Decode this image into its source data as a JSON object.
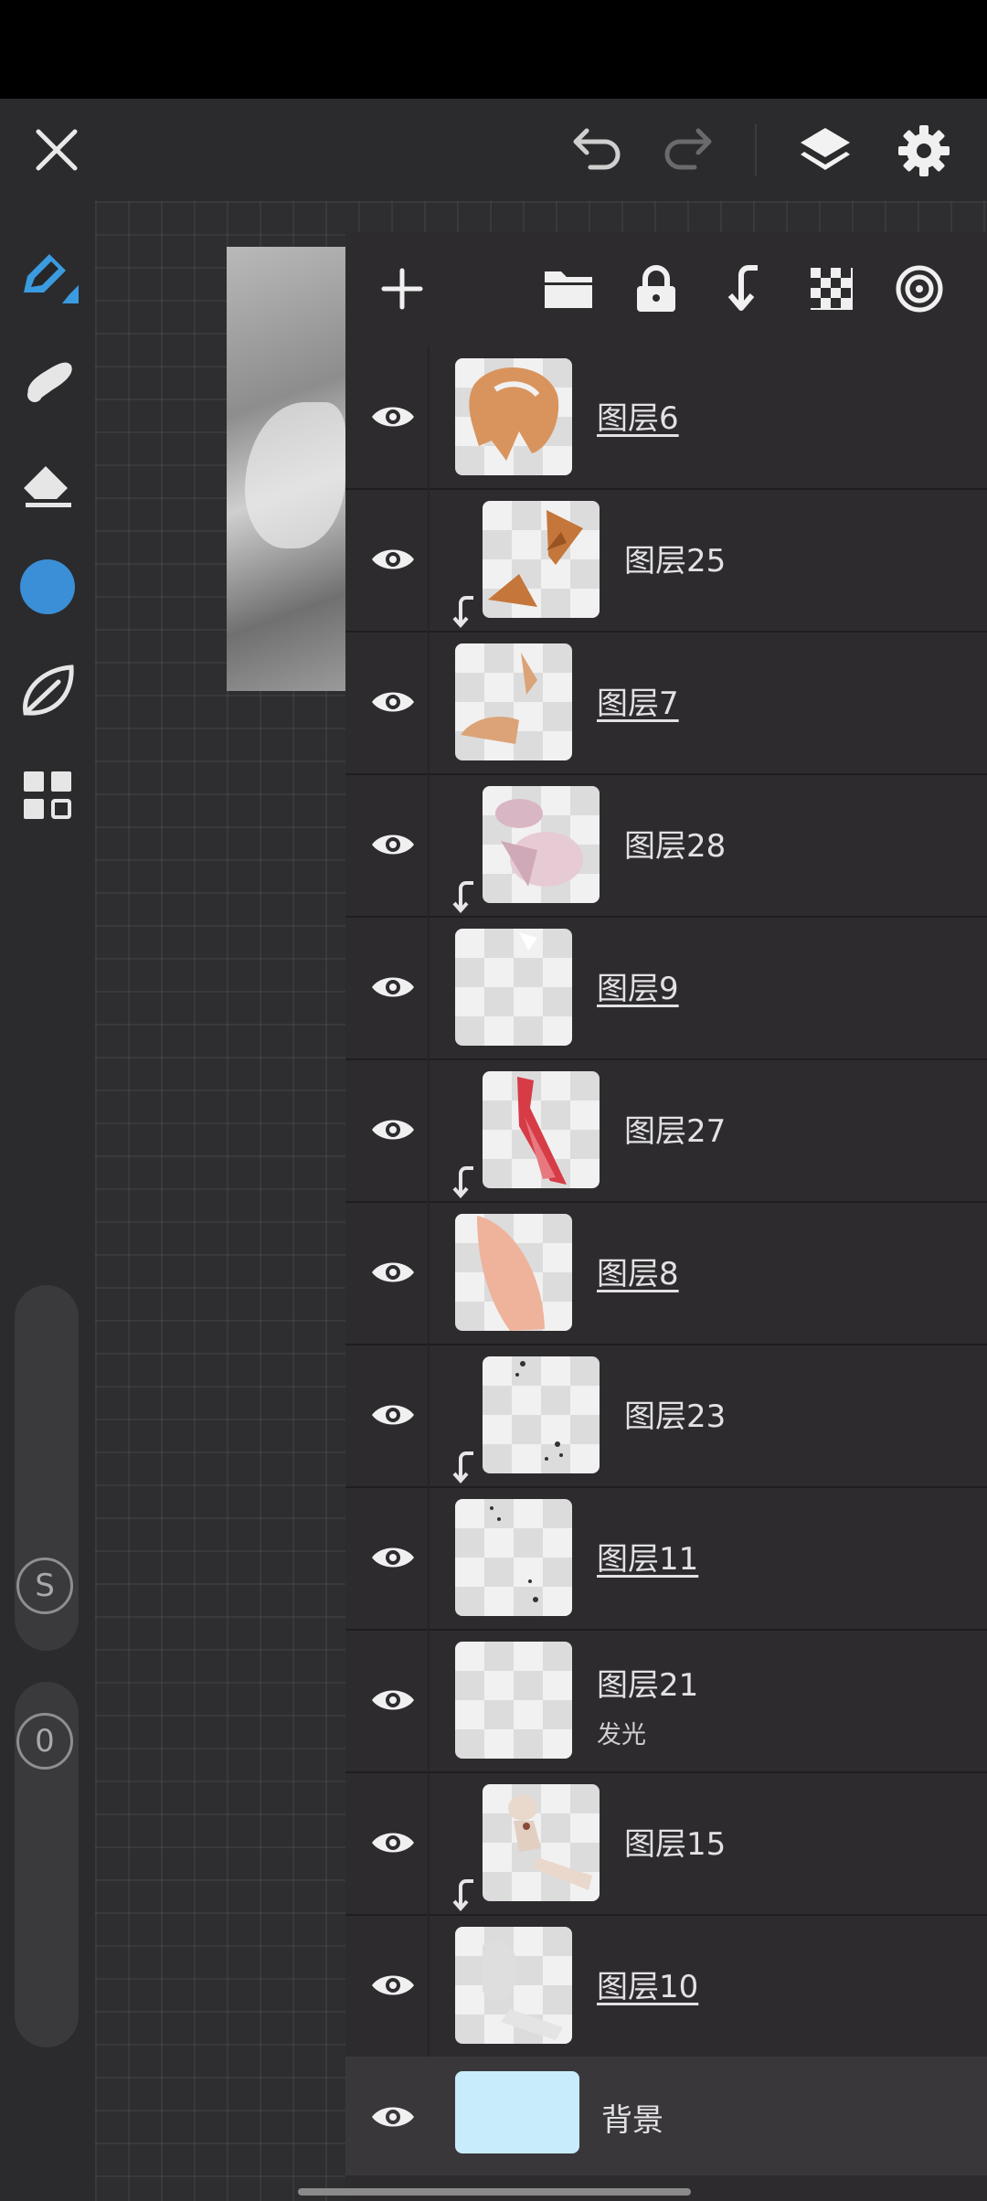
{
  "toolbar": {
    "close_icon": "close-icon",
    "undo_icon": "undo-icon",
    "redo_icon": "redo-icon",
    "layers_icon": "layers-icon",
    "settings_icon": "gear-icon"
  },
  "sidebar": {
    "tools": [
      "brush-icon",
      "smudge-icon",
      "eraser-icon",
      "color-swatch",
      "leaf-icon",
      "grid-icon"
    ],
    "color_value": "#3b8fd6",
    "size_slider_label": "S",
    "opacity_slider_label": "0"
  },
  "layers_panel": {
    "toolbar": [
      "add-icon",
      "folder-icon",
      "lock-icon",
      "merge-down-icon",
      "checker-icon",
      "target-icon"
    ],
    "layers": [
      {
        "name": "图层6",
        "clipped": false,
        "sub": ""
      },
      {
        "name": "图层25",
        "clipped": true,
        "sub": ""
      },
      {
        "name": "图层7",
        "clipped": false,
        "sub": ""
      },
      {
        "name": "图层28",
        "clipped": true,
        "sub": ""
      },
      {
        "name": "图层9",
        "clipped": false,
        "sub": ""
      },
      {
        "name": "图层27",
        "clipped": true,
        "sub": ""
      },
      {
        "name": "图层8",
        "clipped": false,
        "sub": ""
      },
      {
        "name": "图层23",
        "clipped": true,
        "sub": ""
      },
      {
        "name": "图层11",
        "clipped": false,
        "sub": ""
      },
      {
        "name": "图层21",
        "clipped": false,
        "sub": "发光"
      },
      {
        "name": "图层15",
        "clipped": true,
        "sub": ""
      },
      {
        "name": "图层10",
        "clipped": false,
        "sub": ""
      }
    ],
    "background": {
      "name": "背景",
      "color": "#c8ecfb"
    }
  }
}
